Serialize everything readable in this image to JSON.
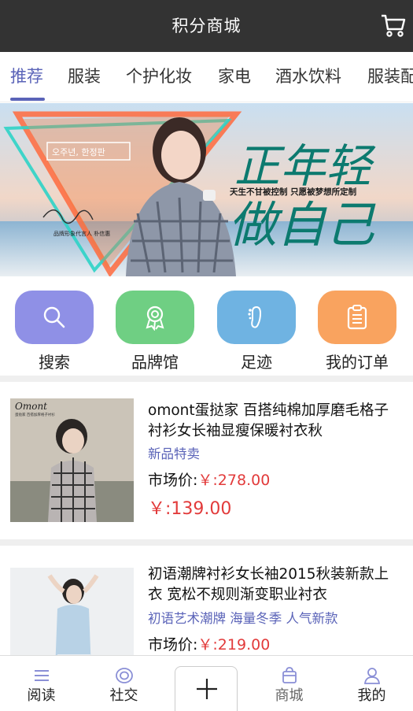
{
  "header": {
    "title": "积分商城",
    "cart_icon": "cart-icon"
  },
  "tabs": [
    {
      "label": "推荐",
      "active": true
    },
    {
      "label": "服装"
    },
    {
      "label": "个护化妆"
    },
    {
      "label": "家电"
    },
    {
      "label": "酒水饮料"
    },
    {
      "label": "服装配"
    }
  ],
  "banner": {
    "headline_top": "正年轻",
    "headline_bottom": "做自己",
    "tagline": "天生不甘被控制  只愿被梦想所定制",
    "caption_korean": "오주년, 한정판",
    "signature_caption": "品牌形象代言人 朴信惠"
  },
  "quick_actions": [
    {
      "label": "搜索",
      "icon": "search-icon",
      "color": "#8f90e6"
    },
    {
      "label": "品牌馆",
      "icon": "ribbon-icon",
      "color": "#6fcf83"
    },
    {
      "label": "足迹",
      "icon": "footprint-icon",
      "color": "#6fb3e2"
    },
    {
      "label": "我的订单",
      "icon": "clipboard-icon",
      "color": "#f9a35f"
    }
  ],
  "products": [
    {
      "name": "omont蛋挞家 百搭纯棉加厚磨毛格子衬衫女长袖显瘦保暖衬衣秋",
      "tag": "新品特卖",
      "market_label": "市场价:",
      "market_price": "￥:278.00",
      "price": "￥:139.00",
      "brand_mark": "Omont",
      "brand_sub": "蛋挞家 百搭加厚格子衬衫"
    },
    {
      "name": "初语潮牌衬衫女长袖2015秋装新款上衣 宽松不规则渐变职业衬衣",
      "tag": "初语艺术潮牌 海量冬季 人气新款",
      "market_label": "市场价:",
      "market_price": "￥:219.00"
    }
  ],
  "bottom_nav": [
    {
      "label": "阅读",
      "icon": "list-icon"
    },
    {
      "label": "社交",
      "icon": "target-icon"
    },
    {
      "label": "",
      "icon": "plus-icon"
    },
    {
      "label": "商城",
      "icon": "shop-icon"
    },
    {
      "label": "我的",
      "icon": "user-icon"
    }
  ]
}
